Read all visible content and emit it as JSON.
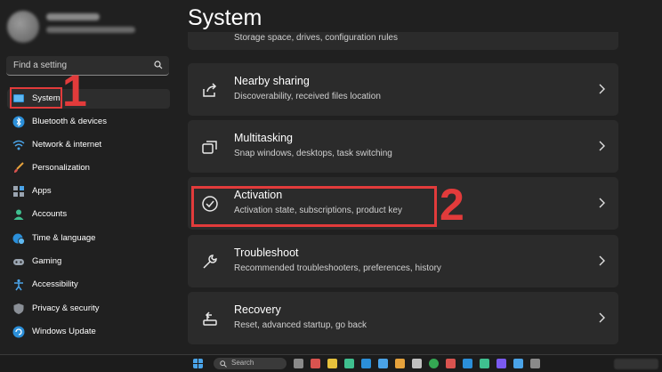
{
  "sidebar": {
    "search_placeholder": "Find a setting",
    "items": [
      {
        "label": "System",
        "icon": "monitor-icon",
        "selected": true
      },
      {
        "label": "Bluetooth & devices",
        "icon": "bluetooth-icon"
      },
      {
        "label": "Network & internet",
        "icon": "wifi-icon"
      },
      {
        "label": "Personalization",
        "icon": "brush-icon"
      },
      {
        "label": "Apps",
        "icon": "apps-icon"
      },
      {
        "label": "Accounts",
        "icon": "person-icon"
      },
      {
        "label": "Time & language",
        "icon": "globe-clock-icon"
      },
      {
        "label": "Gaming",
        "icon": "gamepad-icon"
      },
      {
        "label": "Accessibility",
        "icon": "accessibility-icon"
      },
      {
        "label": "Privacy & security",
        "icon": "shield-icon"
      },
      {
        "label": "Windows Update",
        "icon": "update-icon"
      }
    ]
  },
  "main": {
    "title": "System",
    "partial_card_subtitle": "Storage space, drives, configuration rules",
    "cards": [
      {
        "title": "Nearby sharing",
        "subtitle": "Discoverability, received files location",
        "icon": "share-icon"
      },
      {
        "title": "Multitasking",
        "subtitle": "Snap windows, desktops, task switching",
        "icon": "multitasking-icon"
      },
      {
        "title": "Activation",
        "subtitle": "Activation state, subscriptions, product key",
        "icon": "check-circle-icon"
      },
      {
        "title": "Troubleshoot",
        "subtitle": "Recommended troubleshooters, preferences, history",
        "icon": "wrench-icon"
      },
      {
        "title": "Recovery",
        "subtitle": "Reset, advanced startup, go back",
        "icon": "recovery-icon"
      }
    ]
  },
  "annotations": {
    "step1": "1",
    "step2": "2",
    "highlight_color": "#e23b3b"
  },
  "taskbar": {
    "search_label": "Search"
  }
}
